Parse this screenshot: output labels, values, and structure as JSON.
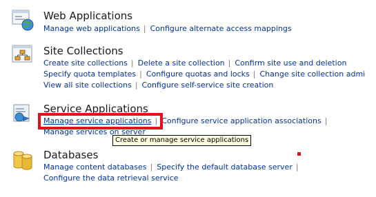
{
  "sections": [
    {
      "title": "Web Applications",
      "icon": "web-application-globe-icon",
      "lines": [
        [
          "Manage web applications",
          "Configure alternate access mappings"
        ]
      ]
    },
    {
      "title": "Site Collections",
      "icon": "site-hierarchy-icon",
      "lines": [
        [
          "Create site collections",
          "Delete a site collection",
          "Confirm site use and deletion"
        ],
        [
          "Specify quota templates",
          "Configure quotas and locks",
          "Change site collection admi"
        ],
        [
          "View all site collections",
          "Configure self-service site creation"
        ]
      ]
    },
    {
      "title": "Service Applications",
      "icon": "service-application-icon",
      "lines": [
        [
          "Manage service applications",
          "Configure service application associations"
        ],
        [
          "Manage services on server"
        ]
      ]
    },
    {
      "title": "Databases",
      "icon": "database-cylinders-icon",
      "lines": [
        [
          "Manage content databases",
          "Specify the default database server"
        ],
        [
          "Configure the data retrieval service"
        ]
      ]
    }
  ],
  "tooltip": "Create or manage service applications",
  "colors": {
    "link": "#0033a0",
    "highlight_border": "#e0101c",
    "tooltip_bg": "#ffffe1"
  }
}
